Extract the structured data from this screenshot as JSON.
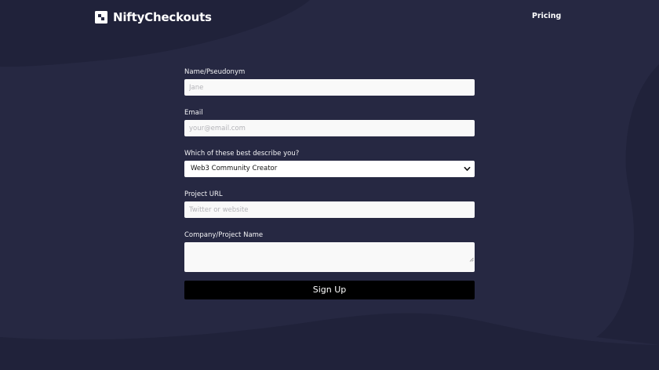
{
  "brand": {
    "name": "NiftyCheckouts"
  },
  "nav": {
    "pricing_label": "Pricing"
  },
  "form": {
    "name": {
      "label": "Name/Pseudonym",
      "placeholder": "Jane",
      "value": ""
    },
    "email": {
      "label": "Email",
      "placeholder": "your@email.com",
      "value": ""
    },
    "role": {
      "label": "Which of these best describe you?",
      "selected": "Web3 Community Creator"
    },
    "project_url": {
      "label": "Project URL",
      "placeholder": "Twitter or website",
      "value": ""
    },
    "company": {
      "label": "Company/Project Name",
      "value": ""
    },
    "submit_label": "Sign Up"
  },
  "colors": {
    "background": "#262842",
    "background_blob": "#20223a",
    "button": "#000000",
    "input": "#f9f9f9"
  }
}
